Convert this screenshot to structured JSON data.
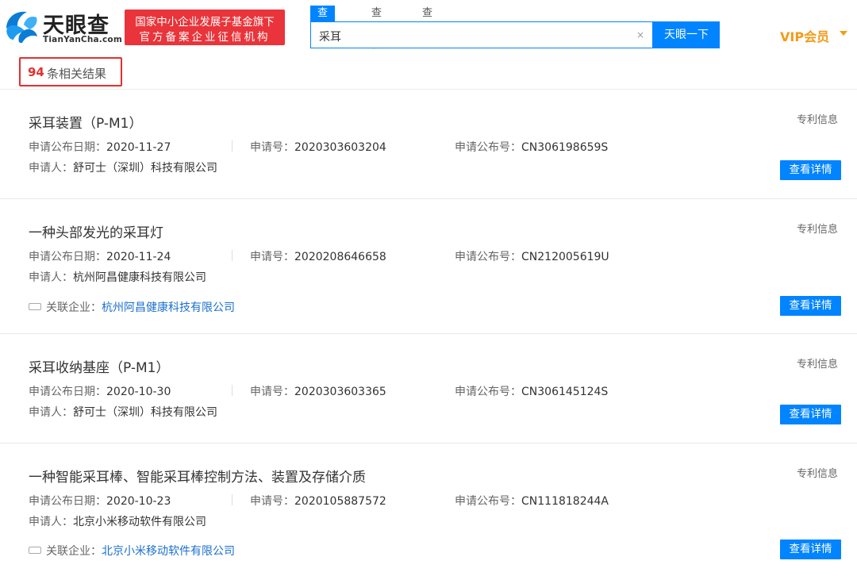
{
  "header": {
    "logo_cn": "天眼查",
    "logo_en": "TianYanCha.com",
    "badge_line1": "国家中小企业发展子基金旗下",
    "badge_line2": "官方备案企业征信机构",
    "tabs": [
      "查公司",
      "查老板",
      "查关系"
    ],
    "search_value": "采耳",
    "clear_icon": "×",
    "search_button": "天眼一下",
    "vip_label": "VIP会员",
    "brand_color": "#0084ff"
  },
  "summary": {
    "count": "94",
    "count_suffix": "条相关结果"
  },
  "labels": {
    "pub_date": "申请公布日期：",
    "app_no": "申请号：",
    "pub_no": "申请公布号：",
    "applicant": "申请人：",
    "related": "关联企业：",
    "type": "专利信息",
    "detail": "查看详情"
  },
  "results": [
    {
      "title": "采耳装置（P-M1）",
      "pub_date": "2020-11-27",
      "app_no": "2020303603204",
      "pub_no": "CN306198659S",
      "applicant": "舒可士（深圳）科技有限公司"
    },
    {
      "title": "一种头部发光的采耳灯",
      "pub_date": "2020-11-24",
      "app_no": "2020208646658",
      "pub_no": "CN212005619U",
      "applicant": "杭州阿昌健康科技有限公司",
      "related": "杭州阿昌健康科技有限公司"
    },
    {
      "title": "采耳收纳基座（P-M1）",
      "pub_date": "2020-10-30",
      "app_no": "2020303603365",
      "pub_no": "CN306145124S",
      "applicant": "舒可士（深圳）科技有限公司"
    },
    {
      "title": "一种智能采耳棒、智能采耳棒控制方法、装置及存储介质",
      "pub_date": "2020-10-23",
      "app_no": "2020105887572",
      "pub_no": "CN111818244A",
      "applicant": "北京小米移动软件有限公司",
      "related": "北京小米移动软件有限公司"
    }
  ]
}
